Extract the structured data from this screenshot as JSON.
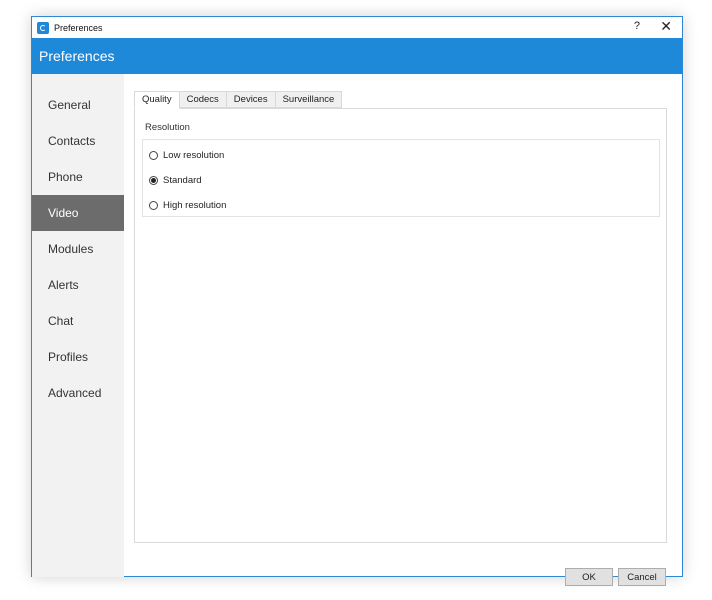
{
  "window": {
    "title": "Preferences",
    "help_glyph": "?",
    "close_glyph": "✕",
    "icon": "app-logo-icon"
  },
  "header": {
    "title": "Preferences"
  },
  "sidebar": {
    "items": [
      {
        "label": "General",
        "active": false
      },
      {
        "label": "Contacts",
        "active": false
      },
      {
        "label": "Phone",
        "active": false
      },
      {
        "label": "Video",
        "active": true
      },
      {
        "label": "Modules",
        "active": false
      },
      {
        "label": "Alerts",
        "active": false
      },
      {
        "label": "Chat",
        "active": false
      },
      {
        "label": "Profiles",
        "active": false
      },
      {
        "label": "Advanced",
        "active": false
      }
    ]
  },
  "tabs": [
    {
      "label": "Quality",
      "active": true
    },
    {
      "label": "Codecs",
      "active": false
    },
    {
      "label": "Devices",
      "active": false
    },
    {
      "label": "Surveillance",
      "active": false
    }
  ],
  "quality": {
    "group_label": "Resolution",
    "options": [
      {
        "label": "Low resolution",
        "selected": false
      },
      {
        "label": "Standard",
        "selected": true
      },
      {
        "label": "High resolution",
        "selected": false
      }
    ]
  },
  "buttons": {
    "ok": "OK",
    "cancel": "Cancel"
  },
  "colors": {
    "accent": "#1e88d9",
    "sidebar_bg": "#f2f2f2",
    "sidebar_active": "#6c6c6c"
  }
}
